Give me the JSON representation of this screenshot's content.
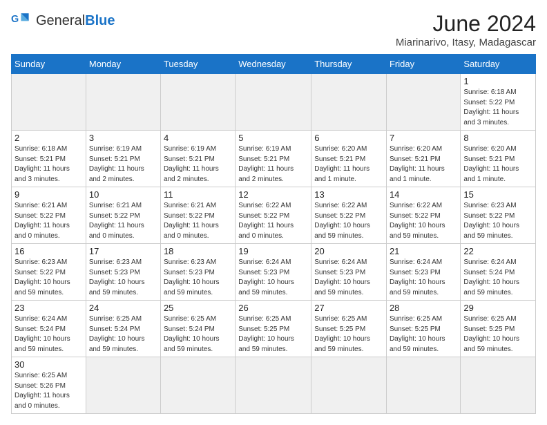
{
  "header": {
    "logo_general": "General",
    "logo_blue": "Blue",
    "title": "June 2024",
    "location": "Miarinarivo, Itasy, Madagascar"
  },
  "days_of_week": [
    "Sunday",
    "Monday",
    "Tuesday",
    "Wednesday",
    "Thursday",
    "Friday",
    "Saturday"
  ],
  "weeks": [
    [
      {
        "day": "",
        "info": "",
        "empty": true
      },
      {
        "day": "",
        "info": "",
        "empty": true
      },
      {
        "day": "",
        "info": "",
        "empty": true
      },
      {
        "day": "",
        "info": "",
        "empty": true
      },
      {
        "day": "",
        "info": "",
        "empty": true
      },
      {
        "day": "",
        "info": "",
        "empty": true
      },
      {
        "day": "1",
        "info": "Sunrise: 6:18 AM\nSunset: 5:22 PM\nDaylight: 11 hours\nand 3 minutes.",
        "empty": false
      }
    ],
    [
      {
        "day": "2",
        "info": "Sunrise: 6:18 AM\nSunset: 5:21 PM\nDaylight: 11 hours\nand 3 minutes.",
        "empty": false
      },
      {
        "day": "3",
        "info": "Sunrise: 6:19 AM\nSunset: 5:21 PM\nDaylight: 11 hours\nand 2 minutes.",
        "empty": false
      },
      {
        "day": "4",
        "info": "Sunrise: 6:19 AM\nSunset: 5:21 PM\nDaylight: 11 hours\nand 2 minutes.",
        "empty": false
      },
      {
        "day": "5",
        "info": "Sunrise: 6:19 AM\nSunset: 5:21 PM\nDaylight: 11 hours\nand 2 minutes.",
        "empty": false
      },
      {
        "day": "6",
        "info": "Sunrise: 6:20 AM\nSunset: 5:21 PM\nDaylight: 11 hours\nand 1 minute.",
        "empty": false
      },
      {
        "day": "7",
        "info": "Sunrise: 6:20 AM\nSunset: 5:21 PM\nDaylight: 11 hours\nand 1 minute.",
        "empty": false
      },
      {
        "day": "8",
        "info": "Sunrise: 6:20 AM\nSunset: 5:21 PM\nDaylight: 11 hours\nand 1 minute.",
        "empty": false
      }
    ],
    [
      {
        "day": "9",
        "info": "Sunrise: 6:21 AM\nSunset: 5:22 PM\nDaylight: 11 hours\nand 0 minutes.",
        "empty": false
      },
      {
        "day": "10",
        "info": "Sunrise: 6:21 AM\nSunset: 5:22 PM\nDaylight: 11 hours\nand 0 minutes.",
        "empty": false
      },
      {
        "day": "11",
        "info": "Sunrise: 6:21 AM\nSunset: 5:22 PM\nDaylight: 11 hours\nand 0 minutes.",
        "empty": false
      },
      {
        "day": "12",
        "info": "Sunrise: 6:22 AM\nSunset: 5:22 PM\nDaylight: 11 hours\nand 0 minutes.",
        "empty": false
      },
      {
        "day": "13",
        "info": "Sunrise: 6:22 AM\nSunset: 5:22 PM\nDaylight: 10 hours\nand 59 minutes.",
        "empty": false
      },
      {
        "day": "14",
        "info": "Sunrise: 6:22 AM\nSunset: 5:22 PM\nDaylight: 10 hours\nand 59 minutes.",
        "empty": false
      },
      {
        "day": "15",
        "info": "Sunrise: 6:23 AM\nSunset: 5:22 PM\nDaylight: 10 hours\nand 59 minutes.",
        "empty": false
      }
    ],
    [
      {
        "day": "16",
        "info": "Sunrise: 6:23 AM\nSunset: 5:22 PM\nDaylight: 10 hours\nand 59 minutes.",
        "empty": false
      },
      {
        "day": "17",
        "info": "Sunrise: 6:23 AM\nSunset: 5:23 PM\nDaylight: 10 hours\nand 59 minutes.",
        "empty": false
      },
      {
        "day": "18",
        "info": "Sunrise: 6:23 AM\nSunset: 5:23 PM\nDaylight: 10 hours\nand 59 minutes.",
        "empty": false
      },
      {
        "day": "19",
        "info": "Sunrise: 6:24 AM\nSunset: 5:23 PM\nDaylight: 10 hours\nand 59 minutes.",
        "empty": false
      },
      {
        "day": "20",
        "info": "Sunrise: 6:24 AM\nSunset: 5:23 PM\nDaylight: 10 hours\nand 59 minutes.",
        "empty": false
      },
      {
        "day": "21",
        "info": "Sunrise: 6:24 AM\nSunset: 5:23 PM\nDaylight: 10 hours\nand 59 minutes.",
        "empty": false
      },
      {
        "day": "22",
        "info": "Sunrise: 6:24 AM\nSunset: 5:24 PM\nDaylight: 10 hours\nand 59 minutes.",
        "empty": false
      }
    ],
    [
      {
        "day": "23",
        "info": "Sunrise: 6:24 AM\nSunset: 5:24 PM\nDaylight: 10 hours\nand 59 minutes.",
        "empty": false
      },
      {
        "day": "24",
        "info": "Sunrise: 6:25 AM\nSunset: 5:24 PM\nDaylight: 10 hours\nand 59 minutes.",
        "empty": false
      },
      {
        "day": "25",
        "info": "Sunrise: 6:25 AM\nSunset: 5:24 PM\nDaylight: 10 hours\nand 59 minutes.",
        "empty": false
      },
      {
        "day": "26",
        "info": "Sunrise: 6:25 AM\nSunset: 5:25 PM\nDaylight: 10 hours\nand 59 minutes.",
        "empty": false
      },
      {
        "day": "27",
        "info": "Sunrise: 6:25 AM\nSunset: 5:25 PM\nDaylight: 10 hours\nand 59 minutes.",
        "empty": false
      },
      {
        "day": "28",
        "info": "Sunrise: 6:25 AM\nSunset: 5:25 PM\nDaylight: 10 hours\nand 59 minutes.",
        "empty": false
      },
      {
        "day": "29",
        "info": "Sunrise: 6:25 AM\nSunset: 5:25 PM\nDaylight: 10 hours\nand 59 minutes.",
        "empty": false
      }
    ],
    [
      {
        "day": "30",
        "info": "Sunrise: 6:25 AM\nSunset: 5:26 PM\nDaylight: 11 hours\nand 0 minutes.",
        "empty": false
      },
      {
        "day": "",
        "info": "",
        "empty": true
      },
      {
        "day": "",
        "info": "",
        "empty": true
      },
      {
        "day": "",
        "info": "",
        "empty": true
      },
      {
        "day": "",
        "info": "",
        "empty": true
      },
      {
        "day": "",
        "info": "",
        "empty": true
      },
      {
        "day": "",
        "info": "",
        "empty": true
      }
    ]
  ]
}
